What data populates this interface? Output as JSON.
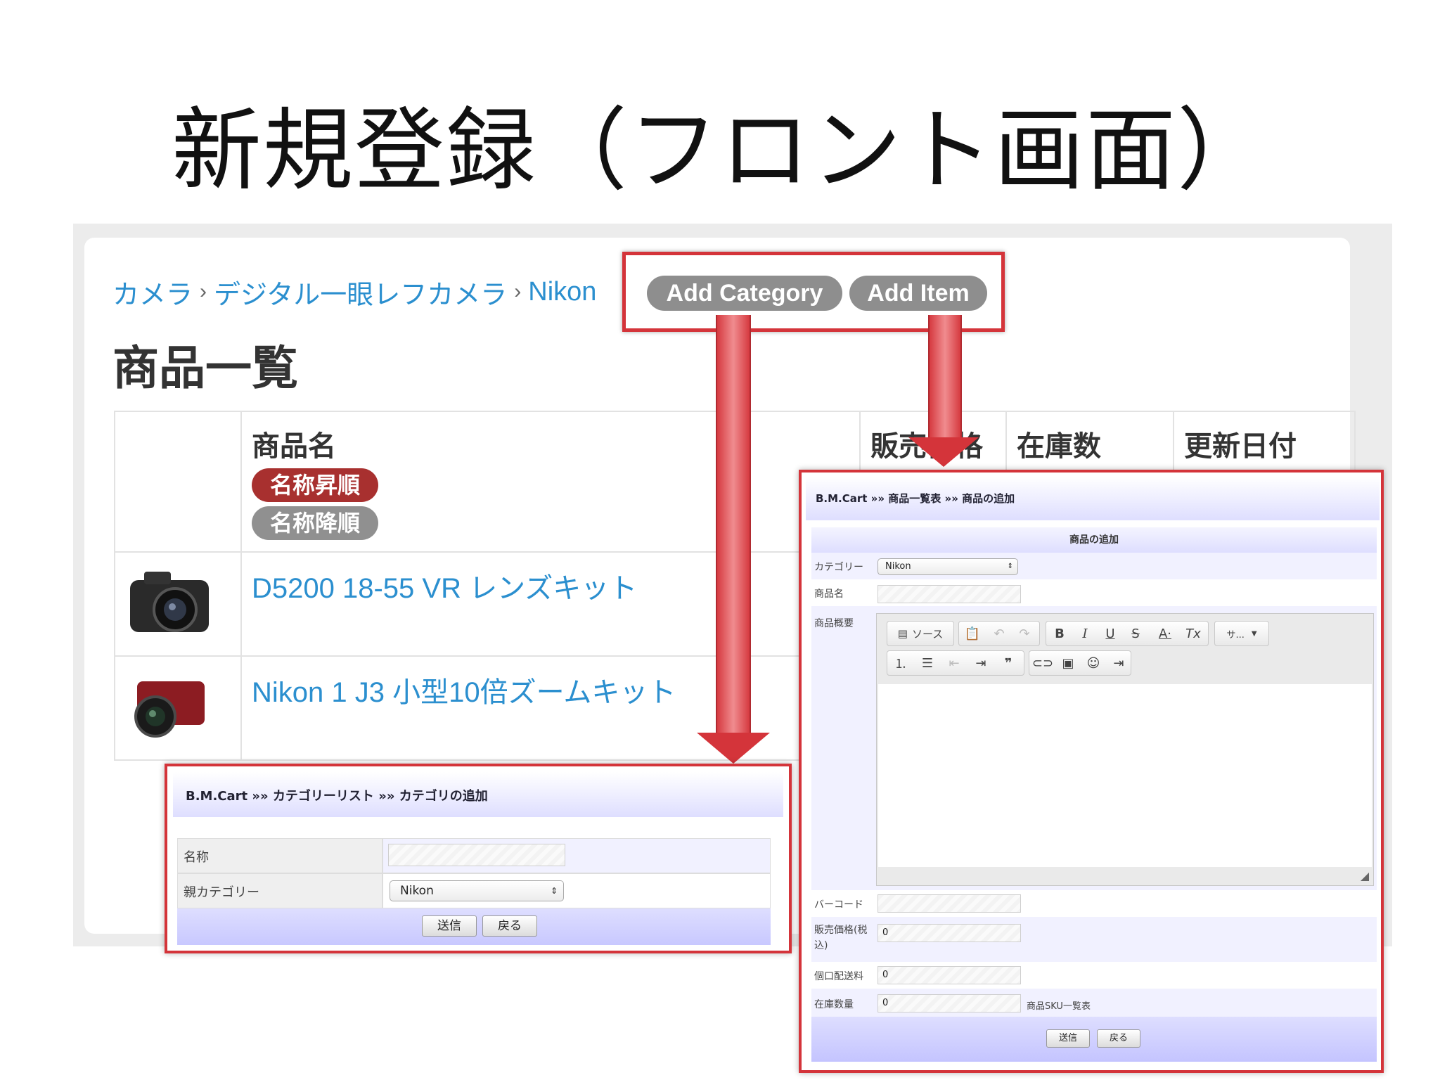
{
  "slide": {
    "title": "新規登録（フロント画面）"
  },
  "colors": {
    "accent_red": "#d4343a",
    "link_blue": "#2b8fcf",
    "sort_active": "#a8302f",
    "pill_gray": "#8e8e8e",
    "form_header": "#dedeff"
  },
  "front": {
    "breadcrumb": [
      "カメラ",
      "デジタル一眼レフカメラ",
      "Nikon"
    ],
    "add_category_label": "Add Category",
    "add_item_label": "Add Item",
    "heading": "商品一覧",
    "table": {
      "headers": [
        "商品名",
        "販売価格",
        "在庫数",
        "更新日付"
      ],
      "sort_asc": "名称昇順",
      "sort_desc": "名称降順",
      "rows": [
        {
          "name": "D5200 18-55 VR レンズキット",
          "image_icon": "camera-black-icon"
        },
        {
          "name": "Nikon 1 J3 小型10倍ズームキット",
          "image_icon": "camera-red-icon"
        }
      ]
    }
  },
  "category_form": {
    "breadcrumb": "B.M.Cart »» カテゴリーリスト »» カテゴリの追加",
    "name_label": "名称",
    "name_value": "",
    "parent_label": "親カテゴリー",
    "parent_value": "Nikon",
    "submit": "送信",
    "back": "戻る"
  },
  "item_form": {
    "breadcrumb": "B.M.Cart »» 商品一覧表 »» 商品の追加",
    "section_title": "商品の追加",
    "category_label": "カテゴリー",
    "category_value": "Nikon",
    "name_label": "商品名",
    "summary_label": "商品概要",
    "source_button": "ソース",
    "format_dropdown": "サ...",
    "barcode_label": "バーコード",
    "price_label": "販売価格(税込)",
    "price_value": "0",
    "shipping_label": "個口配送料",
    "shipping_value": "0",
    "stock_label": "在庫数量",
    "stock_value": "0",
    "sku_link": "商品SKU一覧表",
    "submit": "送信",
    "back": "戻る"
  }
}
